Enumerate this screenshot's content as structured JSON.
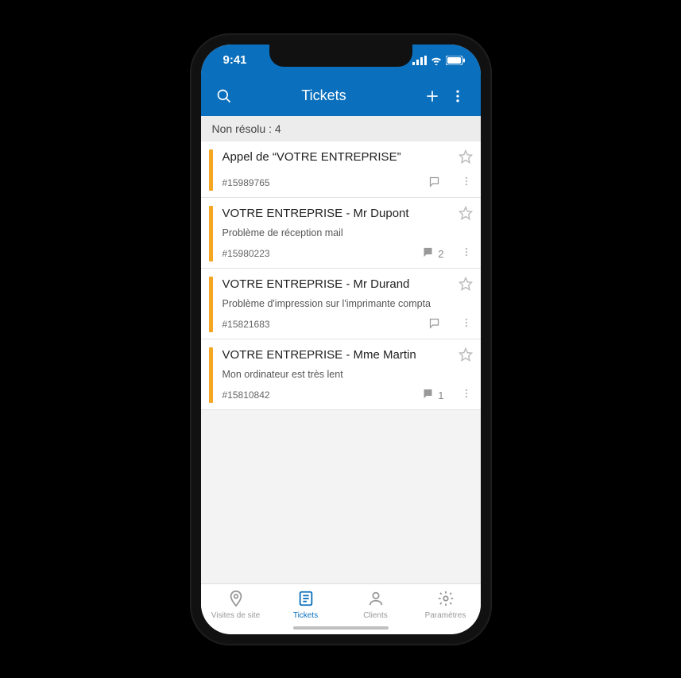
{
  "status_bar": {
    "time": "9:41"
  },
  "header": {
    "title": "Tickets"
  },
  "filter": {
    "label": "Non résolu : 4"
  },
  "tickets": [
    {
      "title": "Appel de “VOTRE ENTREPRISE”",
      "subtitle": "",
      "id": "#15989765",
      "comments": "",
      "comment_filled": false
    },
    {
      "title": "VOTRE ENTREPRISE - Mr Dupont",
      "subtitle": "Problème de réception mail",
      "id": "#15980223",
      "comments": "2",
      "comment_filled": true
    },
    {
      "title": "VOTRE ENTREPRISE - Mr Durand",
      "subtitle": "Problème d'impression sur l'imprimante compta",
      "id": "#15821683",
      "comments": "",
      "comment_filled": false
    },
    {
      "title": "VOTRE ENTREPRISE - Mme Martin",
      "subtitle": "Mon ordinateur est très lent",
      "id": "#15810842",
      "comments": "1",
      "comment_filled": true
    }
  ],
  "nav": {
    "items": [
      {
        "label": "Visites de site"
      },
      {
        "label": "Tickets"
      },
      {
        "label": "Clients"
      },
      {
        "label": "Paramètres"
      }
    ],
    "active_index": 1
  },
  "colors": {
    "accent": "#0a6fbd",
    "priority": "#f5a623"
  }
}
